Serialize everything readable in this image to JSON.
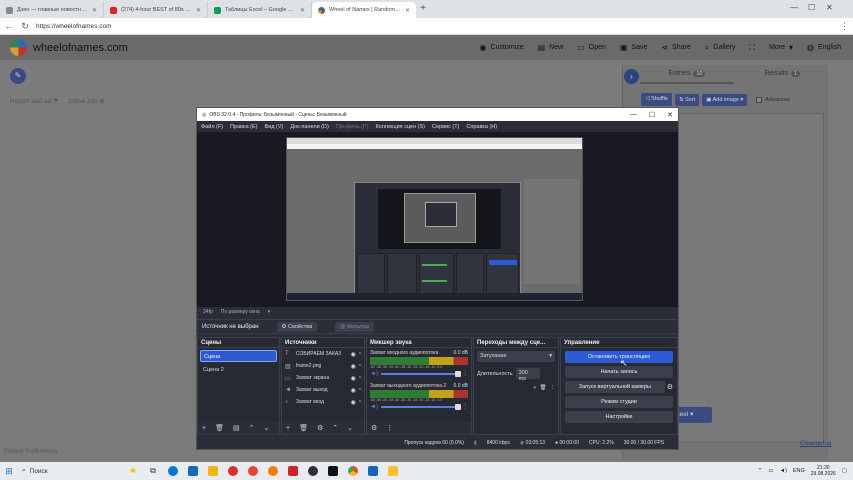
{
  "browser": {
    "tabs": [
      {
        "title": "Дзен — главные новостные инфо",
        "icon_color": "#888888",
        "active": false
      },
      {
        "title": "(274) 4-hour BEST of 80s Dance",
        "icon_color": "#e62117",
        "active": false
      },
      {
        "title": "Таблицы Excel – Google Таблицы",
        "icon_color": "#0f9d58",
        "active": false
      },
      {
        "title": "Wheel of Names | Random name",
        "icon_color": "#c53030",
        "active": true
      }
    ],
    "url": "https://wheelofnames.com",
    "controls": {
      "minimize": "—",
      "maximize": "☐",
      "close": "✕"
    }
  },
  "site": {
    "name": "wheelofnames.com",
    "menu": [
      {
        "label": "Customize",
        "icon": "palette-icon"
      },
      {
        "label": "New",
        "icon": "new-file-icon"
      },
      {
        "label": "Open",
        "icon": "folder-icon"
      },
      {
        "label": "Save",
        "icon": "save-icon"
      },
      {
        "label": "Share",
        "icon": "share-icon"
      },
      {
        "label": "Gallery",
        "icon": "search-icon"
      },
      {
        "label": "",
        "icon": "fullscreen-icon"
      },
      {
        "label": "More",
        "icon": "chevron-down-icon"
      },
      {
        "label": "English",
        "icon": "globe-icon"
      }
    ],
    "report_bad_ad": "Report bad ad",
    "close_ads": "Close ads",
    "entries_tab": "Entries",
    "entries_count": "10",
    "results_tab": "Results",
    "results_count": "1",
    "shuffle": "Shuffle",
    "sort": "Sort",
    "add_image": "Add image",
    "advanced": "Advanced",
    "wheel_button": "heel",
    "changelog": "Changelog",
    "privacy": "Privacy Preferences"
  },
  "obs": {
    "title": "OBS 32.0.4 - Профиль: Безымянный - Сцены: Безымянный",
    "menu": [
      "Файл (F)",
      "Правка (E)",
      "Вид (V)",
      "Док-панели (D)",
      "Профиль (P)",
      "Коллекция сцен (S)",
      "Сервис (T)",
      "Справка (H)"
    ],
    "toolbar": [
      "34fp",
      "По размеру окна"
    ],
    "no_source": "Источник не выбран",
    "properties": "Свойства",
    "filters": "Фильтры",
    "scenes": {
      "header": "Сцены",
      "items": [
        "Сцена",
        "Сцена 2"
      ]
    },
    "sources": {
      "header": "Источники",
      "items": [
        {
          "name": "СОБИРАЕМ ЗАКАЗ",
          "icon": "text-icon"
        },
        {
          "name": "frame2.png",
          "icon": "image-icon"
        },
        {
          "name": "Захват экрана",
          "icon": "monitor-icon"
        },
        {
          "name": "Захват выход",
          "icon": "speaker-icon"
        },
        {
          "name": "Захват вход",
          "icon": "mic-icon"
        }
      ]
    },
    "mixer": {
      "header": "Микшер звука",
      "channels": [
        {
          "name": "Захват входного аудиопотока",
          "db": "0.0 dB",
          "level": 0.8
        },
        {
          "name": "Захват выходного аудиопотока 2",
          "db": "0.0 dB",
          "level": 0.8
        }
      ],
      "ticks": "-60 -55 -50 -45 -40 -35 -30 -25 -20 -15 -10 -5 0"
    },
    "transitions": {
      "header": "Переходы между сце...",
      "type": "Затухание",
      "duration_label": "Длительность",
      "duration_value": "300 ms"
    },
    "controls": {
      "header": "Управление",
      "buttons": [
        {
          "label": "Остановить трансляцию",
          "active": true
        },
        {
          "label": "Начать запись",
          "active": false
        },
        {
          "label": "Запуск виртуальной камеры",
          "active": false
        },
        {
          "label": "Режим студии",
          "active": false
        },
        {
          "label": "Настройки",
          "active": false
        }
      ]
    },
    "status": {
      "dropped": "Пропуск кадров 60 (0.0%)",
      "bitrate": "8400 kbps",
      "stream_time": "03:05:13",
      "rec_time": "00:00:00",
      "cpu": "CPU: 2.2%",
      "fps": "30.00 / 30.00 FPS"
    }
  },
  "taskbar": {
    "search": "Поиск",
    "apps": [
      {
        "name": "task-view-icon",
        "color": "#333333"
      },
      {
        "name": "edge-icon",
        "color": "#0078d4"
      },
      {
        "name": "mail-icon",
        "color": "#0f6cbd"
      },
      {
        "name": "explorer-icon",
        "color": "#f2b600"
      },
      {
        "name": "yandex-icon",
        "color": "#d93025"
      },
      {
        "name": "yandex-browser-icon",
        "color": "#e94235"
      },
      {
        "name": "app-orange-icon",
        "color": "#f57c00"
      },
      {
        "name": "app-red-icon",
        "color": "#c62828"
      },
      {
        "name": "obs-icon",
        "color": "#302e31"
      },
      {
        "name": "app-h-icon",
        "color": "#111111"
      },
      {
        "name": "chrome-icon",
        "color": "#34a853"
      },
      {
        "name": "app-blue-icon",
        "color": "#1565c0"
      },
      {
        "name": "app-yellow-icon",
        "color": "#fbc02d"
      }
    ],
    "lang": "ENG",
    "time": "21:30",
    "date": "29.08.2026"
  }
}
